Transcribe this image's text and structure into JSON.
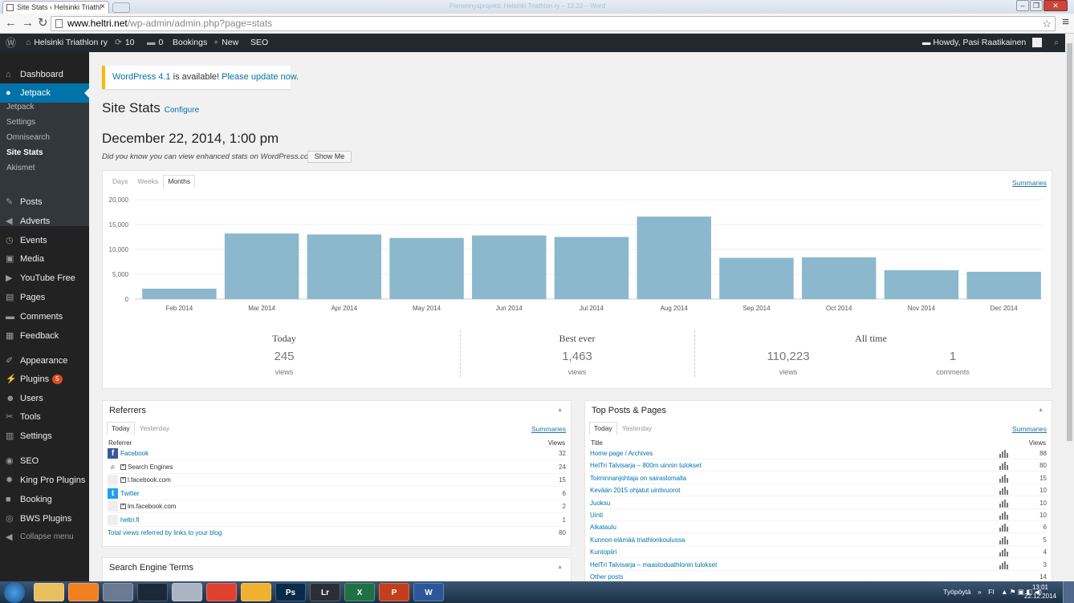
{
  "browser": {
    "tab_title": "Site Stats ‹ Helsinki Triathl",
    "window_title": "Pienennysprojekti: Helsinki Triathlon ry – 12.22 – Word",
    "url_host": "www.heltri.net",
    "url_path": "/wp-admin/admin.php?page=stats"
  },
  "adminbar": {
    "site": "Helsinki Triathlon ry",
    "updates": "10",
    "comments": "0",
    "bookings": "Bookings",
    "new": "New",
    "seo": "SEO",
    "howdy": "Howdy, Pasi Raatikainen"
  },
  "sidebar": {
    "items": [
      {
        "label": "Dashboard",
        "icon": "dashboard-icon",
        "glyph": "⌂"
      },
      {
        "label": "Jetpack",
        "icon": "jetpack-icon",
        "glyph": "●"
      },
      {
        "label": "Posts",
        "icon": "pin-icon",
        "glyph": "✎"
      },
      {
        "label": "Adverts",
        "icon": "megaphone-icon",
        "glyph": "◀"
      },
      {
        "label": "Events",
        "icon": "calendar-icon",
        "glyph": "◷"
      },
      {
        "label": "Media",
        "icon": "media-icon",
        "glyph": "▣"
      },
      {
        "label": "YouTube Free",
        "icon": "youtube-icon",
        "glyph": "▶"
      },
      {
        "label": "Pages",
        "icon": "pages-icon",
        "glyph": "▤"
      },
      {
        "label": "Comments",
        "icon": "comment-icon",
        "glyph": "▬"
      },
      {
        "label": "Feedback",
        "icon": "feedback-icon",
        "glyph": "▦"
      },
      {
        "label": "Appearance",
        "icon": "brush-icon",
        "glyph": "✐"
      },
      {
        "label": "Plugins",
        "icon": "plugin-icon",
        "glyph": "⚡",
        "badge": "5"
      },
      {
        "label": "Users",
        "icon": "user-icon",
        "glyph": "☻"
      },
      {
        "label": "Tools",
        "icon": "wrench-icon",
        "glyph": "✂"
      },
      {
        "label": "Settings",
        "icon": "settings-icon",
        "glyph": "▥"
      },
      {
        "label": "SEO",
        "icon": "seo-icon",
        "glyph": "◉"
      },
      {
        "label": "King Pro Plugins",
        "icon": "gear-icon",
        "glyph": "✹"
      },
      {
        "label": "Booking",
        "icon": "booking-icon",
        "glyph": "■"
      },
      {
        "label": "BWS Plugins",
        "icon": "bws-icon",
        "glyph": "◎"
      },
      {
        "label": "Collapse menu",
        "icon": "collapse-icon",
        "glyph": "◀"
      }
    ],
    "submenu": [
      "Jetpack",
      "Settings",
      "Omnisearch",
      "Site Stats",
      "Akismet"
    ]
  },
  "notice": {
    "link": "WordPress 4.1",
    "text": " is available! ",
    "update": "Please update now",
    "end": "."
  },
  "page": {
    "title": "Site Stats",
    "configure": "Configure",
    "date": "December 22, 2014, 1:00 pm",
    "hint": "Did you know you can view enhanced stats on WordPress.com?",
    "show_me": "Show Me"
  },
  "stats_tabs": [
    "Days",
    "Weeks",
    "Months"
  ],
  "summaries": "Summaries",
  "chart_data": {
    "type": "bar",
    "categories": [
      "Feb 2014",
      "Mar 2014",
      "Apr 2014",
      "May 2014",
      "Jun 2014",
      "Jul 2014",
      "Aug 2014",
      "Sep 2014",
      "Oct 2014",
      "Nov 2014",
      "Dec 2014"
    ],
    "values": [
      2100,
      13200,
      13000,
      12300,
      12800,
      12500,
      16600,
      8300,
      8400,
      5800,
      5500
    ],
    "yticks": [
      "20,000",
      "15,000",
      "10,000",
      "5,000",
      "0"
    ],
    "ylim": [
      0,
      20000
    ],
    "color": "#8bb8cc"
  },
  "summary": {
    "today": {
      "label": "Today",
      "value": "245",
      "unit": "views"
    },
    "best": {
      "label": "Best ever",
      "value": "1,463",
      "unit": "views"
    },
    "alltime": {
      "label": "All time",
      "views": "110,223",
      "views_unit": "views",
      "comments": "1",
      "comments_unit": "comments"
    }
  },
  "referrers": {
    "title": "Referrers",
    "tabs": [
      "Today",
      "Yesterday"
    ],
    "col_left": "Referrer",
    "col_right": "Views",
    "rows": [
      {
        "name": "Facebook",
        "views": "32",
        "icon": "facebook-icon"
      },
      {
        "name": "Search Engines",
        "views": "24",
        "icon": "search-icon"
      },
      {
        "name": "l.facebook.com",
        "views": "15",
        "icon": "blank-icon"
      },
      {
        "name": "Twitter",
        "views": "6",
        "icon": "twitter-icon"
      },
      {
        "name": "lm.facebook.com",
        "views": "2",
        "icon": "blank-icon"
      },
      {
        "name": "heltri.fi",
        "views": "1",
        "icon": "blank-icon"
      }
    ],
    "total_label": "Total views referred by links to your blog",
    "total": "80"
  },
  "top_posts": {
    "title": "Top Posts & Pages",
    "tabs": [
      "Today",
      "Yesterday"
    ],
    "col_left": "Title",
    "col_right": "Views",
    "rows": [
      {
        "name": "Home page / Archives",
        "views": "88"
      },
      {
        "name": "HelTri Talvisarja – 800m uinnin tulokset",
        "views": "80"
      },
      {
        "name": "Toiminnanjohtaja on sairaslomalla",
        "views": "15"
      },
      {
        "name": "Kevään 2015 ohjatut uintivuorot",
        "views": "10"
      },
      {
        "name": "Juoksu",
        "views": "10"
      },
      {
        "name": "Uinti",
        "views": "10"
      },
      {
        "name": "Aikataulu",
        "views": "6"
      },
      {
        "name": "Kunnon elämää triathlonkoulussa",
        "views": "5"
      },
      {
        "name": "Kuntopiiri",
        "views": "4"
      },
      {
        "name": "HelTri Talvisarja – maastoduathlonin tulokset",
        "views": "3"
      },
      {
        "name": "Other posts",
        "views": "14"
      }
    ]
  },
  "search_terms": {
    "title": "Search Engine Terms"
  },
  "taskbar": {
    "desktop": "Työpöytä",
    "lang": "FI",
    "time": "13:01",
    "date": "22.12.2014",
    "apps": [
      {
        "label": "",
        "color": "#e8c060"
      },
      {
        "label": "",
        "color": "#f08020"
      },
      {
        "label": "",
        "color": "#6a7a90"
      },
      {
        "label": "",
        "color": "#1b2838"
      },
      {
        "label": "",
        "color": "#aab4c4"
      },
      {
        "label": "",
        "color": "#e04030"
      },
      {
        "label": "",
        "color": "#f0b030"
      },
      {
        "label": "Ps",
        "color": "#0a2a4a"
      },
      {
        "label": "Lr",
        "color": "#2a2f36"
      },
      {
        "label": "X",
        "color": "#1e7145"
      },
      {
        "label": "P",
        "color": "#c43e1c"
      },
      {
        "label": "W",
        "color": "#2b579a"
      }
    ]
  }
}
